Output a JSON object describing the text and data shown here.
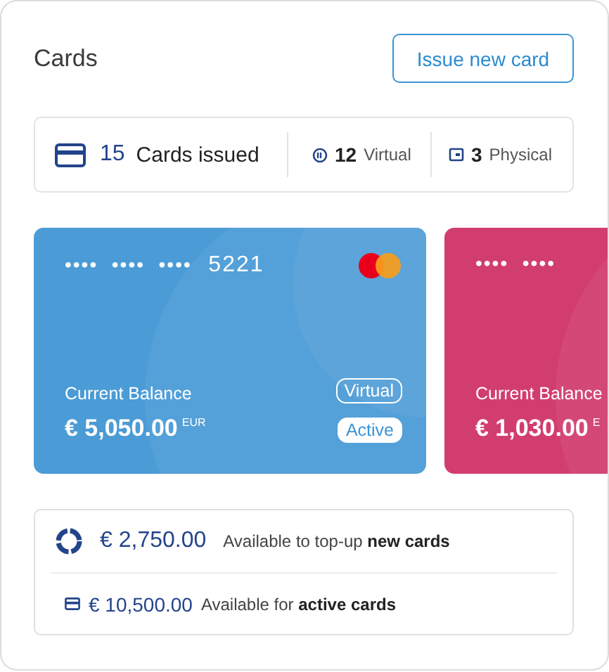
{
  "title": "Cards",
  "issue_button": "Issue new card",
  "stats": [
    {
      "kind": "total",
      "count": "15",
      "label": "Cards issued"
    },
    {
      "kind": "virtual",
      "count": "12",
      "label": "Virtual"
    },
    {
      "kind": "physical",
      "count": "3",
      "label": "Physical"
    }
  ],
  "cards": [
    {
      "number_groups": [
        "••••",
        "••••",
        "••••"
      ],
      "last_digits": "5221",
      "brand_logo": true,
      "balance_label": "Current Balance",
      "balance": "€ 5,050.00",
      "currency": "EUR",
      "type_badge": "Virtual",
      "status_badge": "Active",
      "color": "#4a9bd6"
    },
    {
      "number_groups": [
        "••••",
        "••••"
      ],
      "balance_label": "Current Balance",
      "balance": "€ 1,030.00",
      "currency": "E",
      "color": "#d23d6f"
    }
  ],
  "summary": [
    {
      "kind": "donut",
      "amount": "€ 2,750.00",
      "text": "Available to top-up **new cards**"
    },
    {
      "kind": "card",
      "amount": "€ 10,500.00",
      "text": "Available for **active cards**"
    }
  ]
}
